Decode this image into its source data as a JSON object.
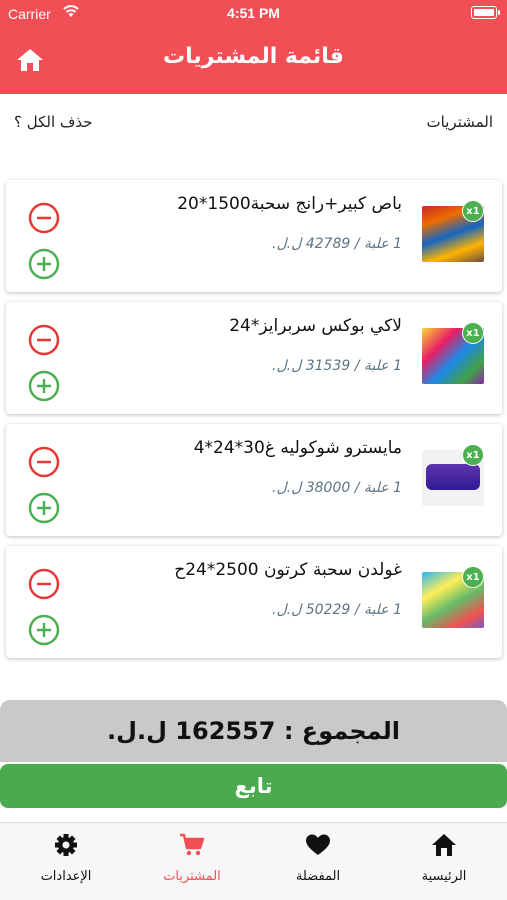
{
  "status": {
    "carrier": "Carrier",
    "time": "4:51 PM"
  },
  "header": {
    "title": "قائمة المشتريات"
  },
  "subheader": {
    "right_label": "المشتريات",
    "left_label": "حذف الكل ؟"
  },
  "items": [
    {
      "name": "باص كبير+رانج سحبة1500*20",
      "price": "1 علبة / 42789 ل.ل.",
      "qty": "x1"
    },
    {
      "name": "لاكي بوكس سربرايز*24",
      "price": "1 علبة / 31539 ل.ل.",
      "qty": "x1"
    },
    {
      "name": "مايسترو شوكوليه غ30*24*4",
      "price": "1 علبة / 38000 ل.ل.",
      "qty": "x1"
    },
    {
      "name": "غولدن سحبة كرتون 2500*24ح",
      "price": "1 علبة / 50229 ل.ل.",
      "qty": "x1"
    }
  ],
  "total": {
    "text": "المجموع : 162557 ل.ل."
  },
  "continue": {
    "label": "تابع"
  },
  "tabs": [
    {
      "label": "الرئيسية",
      "icon": "home-icon"
    },
    {
      "label": "المفضلة",
      "icon": "heart-icon"
    },
    {
      "label": "المشتريات",
      "icon": "cart-icon"
    },
    {
      "label": "الإعدادات",
      "icon": "gear-icon"
    }
  ],
  "colors": {
    "primary": "#f24e55",
    "success": "#4aaa4d",
    "remove": "#e53935",
    "qty_badge": "#4caf50"
  }
}
